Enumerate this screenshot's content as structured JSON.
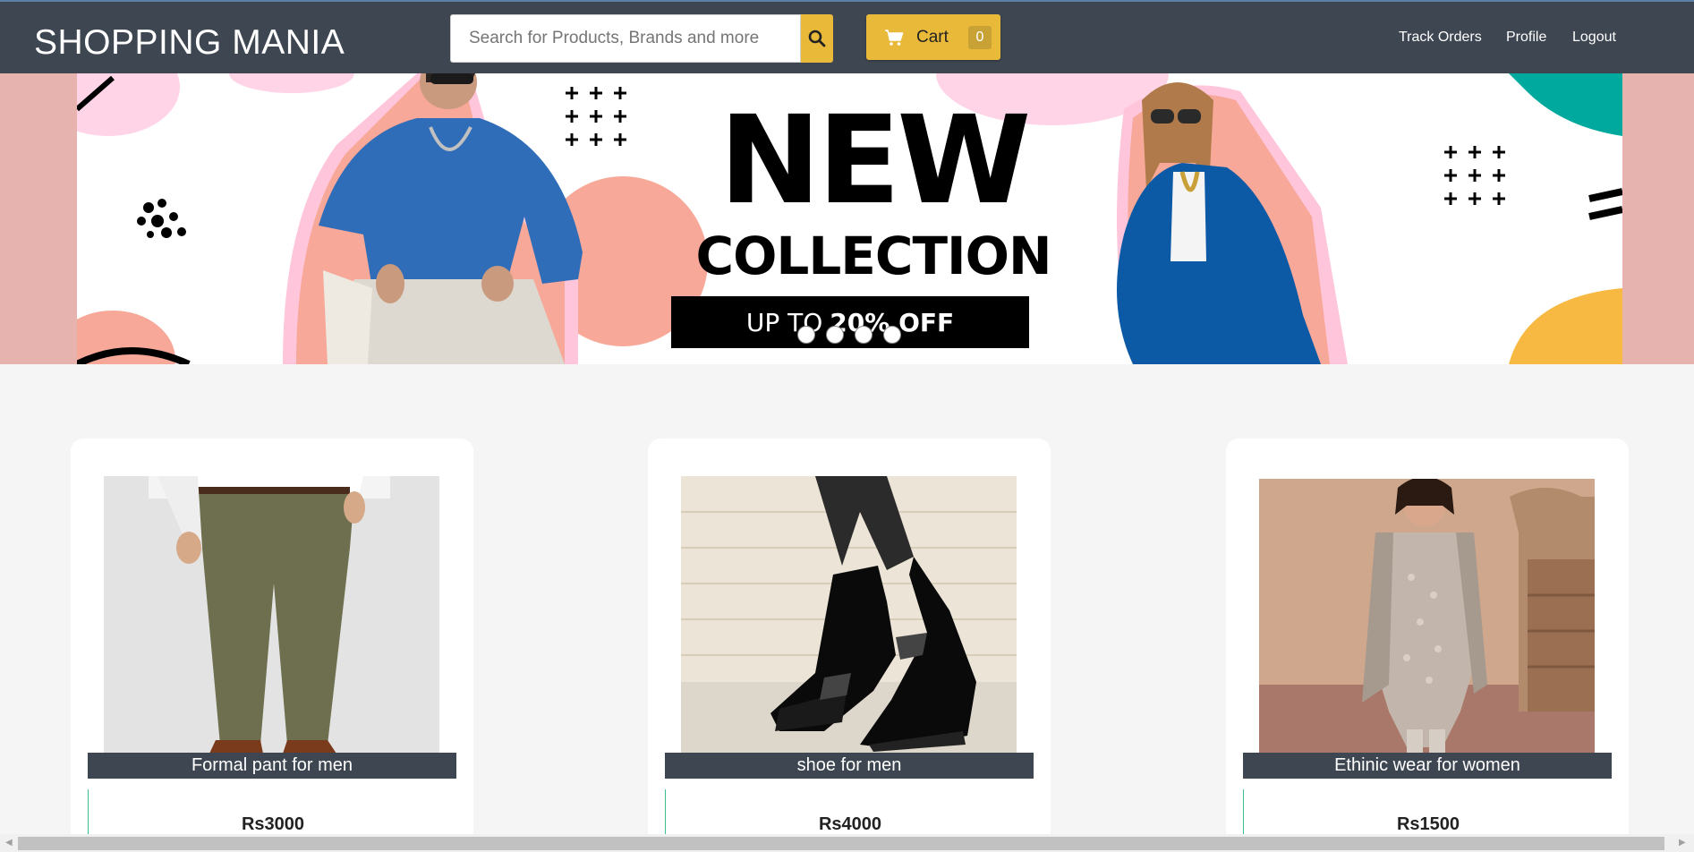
{
  "header": {
    "brand": "SHOPPING MANIA",
    "search_placeholder": "Search for Products, Brands and more",
    "cart_label": "Cart",
    "cart_count": "0",
    "nav": [
      "Track Orders",
      "Profile",
      "Logout"
    ],
    "accent_color": "#e9b93a",
    "bar_color": "#3e4651"
  },
  "banner": {
    "title": "NEW",
    "subtitle": "COLLECTION",
    "offer_prefix": "UP TO",
    "offer_value": "20% OFF",
    "slides": 4,
    "active_slide": 1
  },
  "products": [
    {
      "name": "Formal pant for men",
      "price": "Rs3000"
    },
    {
      "name": "shoe for men",
      "price": "Rs4000"
    },
    {
      "name": "Ethinic wear for women",
      "price": "Rs1500"
    }
  ]
}
